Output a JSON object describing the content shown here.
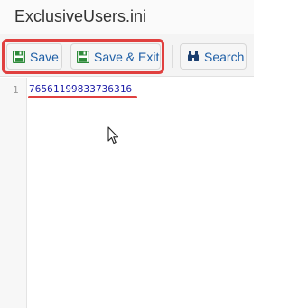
{
  "window": {
    "title": "ExclusiveUsers.ini"
  },
  "toolbar": {
    "save_label": "Save",
    "save_exit_label": "Save & Exit",
    "search_label": "Search",
    "icons": {
      "save": "floppy-disk-icon",
      "save_exit": "floppy-disk-icon",
      "search": "binoculars-icon"
    }
  },
  "editor": {
    "lines": [
      {
        "number": "1",
        "text": "76561199833736316"
      }
    ]
  },
  "colors": {
    "accent": "#1f5fa6",
    "highlight": "#e0403f",
    "save_icon": "#2e8b3a",
    "code_text": "#1a1aa6"
  }
}
